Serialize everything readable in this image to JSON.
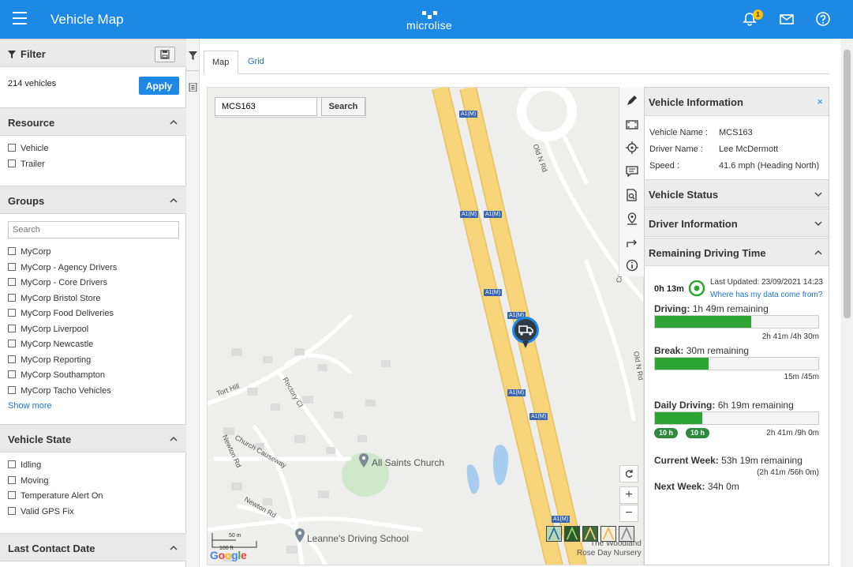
{
  "header": {
    "title": "Vehicle Map",
    "brand": "microlise",
    "notification_count": "1"
  },
  "filter": {
    "title": "Filter",
    "vehicle_count": "214 vehicles",
    "apply_label": "Apply"
  },
  "resource": {
    "title": "Resource",
    "items": [
      "Vehicle",
      "Trailer"
    ]
  },
  "groups": {
    "title": "Groups",
    "search_placeholder": "Search",
    "items": [
      "MyCorp",
      "MyCorp - Agency Drivers",
      "MyCorp - Core Drivers",
      "MyCorp Bristol Store",
      "MyCorp Food Deliveries",
      "MyCorp Liverpool",
      "MyCorp Newcastle",
      "MyCorp Reporting",
      "MyCorp Southampton",
      "MyCorp Tacho Vehicles"
    ],
    "show_more": "Show more"
  },
  "vehicle_state": {
    "title": "Vehicle State",
    "items": [
      "Idling",
      "Moving",
      "Temperature Alert On",
      "Valid GPS Fix"
    ]
  },
  "last_contact": {
    "title": "Last Contact Date"
  },
  "tabs": [
    "Map",
    "Grid"
  ],
  "map": {
    "search_value": "MCS163",
    "search_button": "Search",
    "road_badge": "A1(M)",
    "labels": {
      "old_n_rd": "Old N Rd",
      "tort_hill": "Tort Hill",
      "rectory_cl": "Rectory Cl",
      "newton_rd": "Newton Rd",
      "church_causeway": "Church Causeway",
      "newton_rd2": "Newton Rd",
      "cou": "Cou",
      "woodland": "The Woodland",
      "rose_day": "Rose Day Nursery"
    },
    "pois": {
      "church": "All Saints Church",
      "school": "Leanne's Driving School"
    },
    "scale": {
      "metric": "50 m",
      "imperial": "100 ft"
    },
    "google": "Google",
    "zoom_in": "+",
    "zoom_out": "−"
  },
  "vehicle_info": {
    "title": "Vehicle Information",
    "close": "×",
    "rows": [
      {
        "label": "Vehicle Name :",
        "value": "MCS163"
      },
      {
        "label": "Driver Name :",
        "value": "Lee McDermott"
      },
      {
        "label": "Speed :",
        "value": "41.6 mph (Heading North)"
      }
    ]
  },
  "vehicle_status": {
    "title": "Vehicle Status"
  },
  "driver_information": {
    "title": "Driver Information"
  },
  "remaining_driving_time": {
    "title": "Remaining Driving Time",
    "time": "0h 13m",
    "last_updated": "Last Updated: 23/09/2021 14:23",
    "data_link": "Where has my data come from?",
    "driving": {
      "label": "Driving:",
      "value": "1h 49m remaining",
      "sub": "2h 41m /4h 30m",
      "fill": 0.59
    },
    "break": {
      "label": "Break:",
      "value": "30m remaining",
      "sub": "15m /45m",
      "fill": 0.33
    },
    "daily": {
      "label": "Daily Driving:",
      "value": "6h 19m remaining",
      "sub": "2h 41m /9h 0m",
      "fill": 0.29,
      "pills": [
        "10 h",
        "10 h"
      ]
    },
    "current_week": {
      "label": "Current Week:",
      "value": "53h 19m remaining",
      "sub": "(2h 41m /56h 0m)"
    },
    "next_week": {
      "label": "Next Week:",
      "value": "34h 0m"
    }
  },
  "colors": {
    "primary": "#1e88e5",
    "progress": "#2fa436",
    "road": "#f7d37a",
    "water": "#a6cdef",
    "park": "#cfe8c9"
  }
}
